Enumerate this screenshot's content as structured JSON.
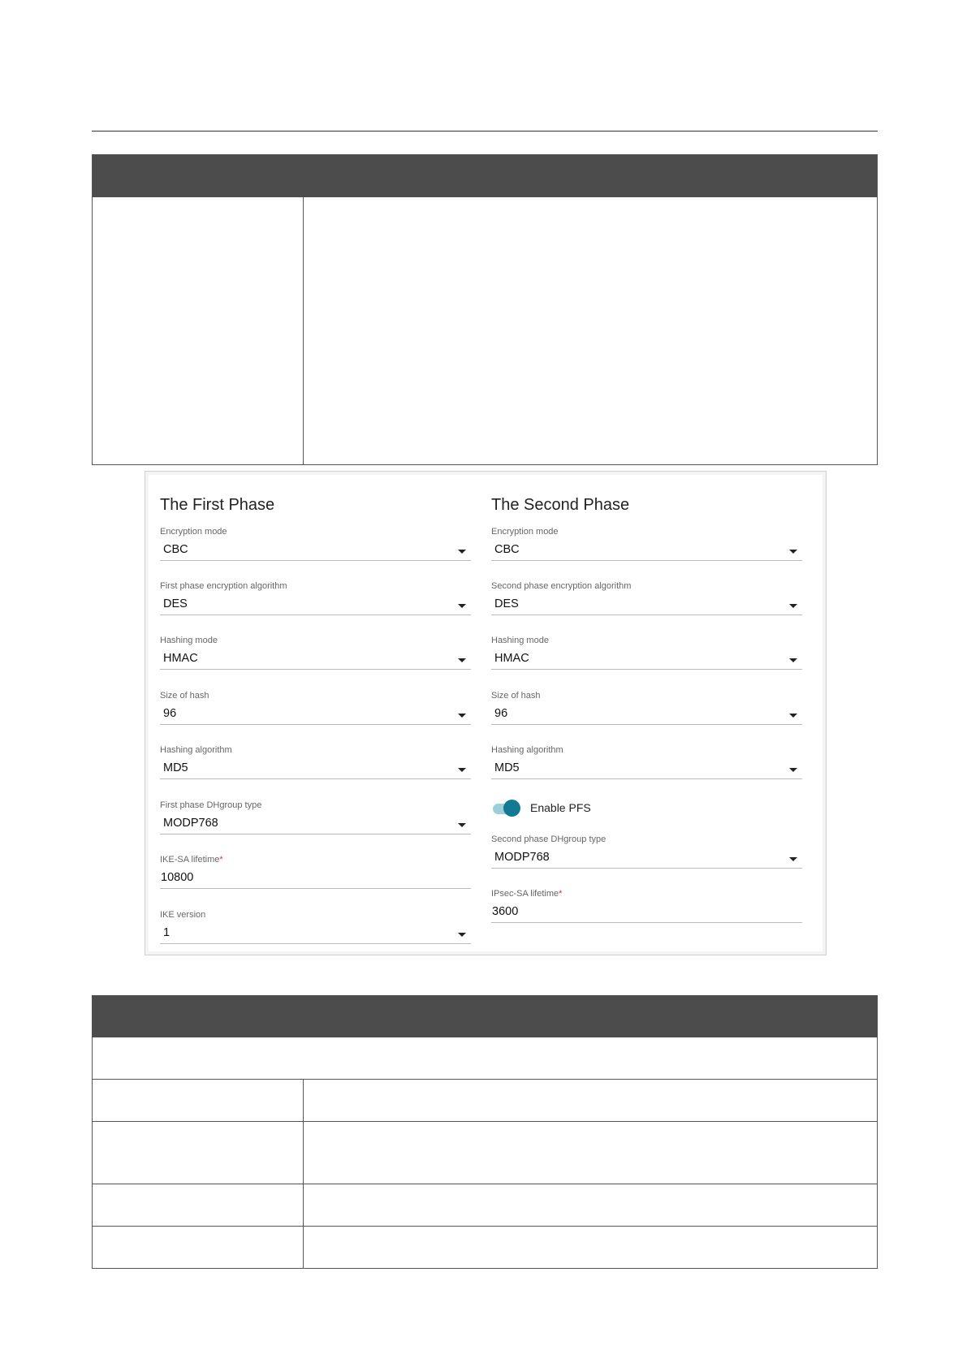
{
  "first_phase": {
    "title": "The First Phase",
    "fields": [
      {
        "label": "Encryption mode",
        "value": "CBC"
      },
      {
        "label": "First phase encryption algorithm",
        "value": "DES"
      },
      {
        "label": "Hashing mode",
        "value": "HMAC"
      },
      {
        "label": "Size of hash",
        "value": "96"
      },
      {
        "label": "Hashing algorithm",
        "value": "MD5"
      },
      {
        "label": "First phase DHgroup type",
        "value": "MODP768"
      },
      {
        "label": "IKE-SA lifetime",
        "required_mark": "*",
        "value": "10800"
      },
      {
        "label": "IKE version",
        "value": "1"
      }
    ]
  },
  "second_phase": {
    "title": "The Second Phase",
    "fields": [
      {
        "label": "Encryption mode",
        "value": "CBC"
      },
      {
        "label": "Second phase encryption algorithm",
        "value": "DES"
      },
      {
        "label": "Hashing mode",
        "value": "HMAC"
      },
      {
        "label": "Size of hash",
        "value": "96"
      },
      {
        "label": "Hashing algorithm",
        "value": "MD5"
      },
      {
        "label": "Second phase DHgroup type",
        "value": "MODP768"
      },
      {
        "label": "IPsec-SA lifetime",
        "required_mark": "*",
        "value": "3600"
      }
    ],
    "pfs": {
      "label": "Enable PFS",
      "enabled": true
    }
  },
  "colors": {
    "table_header": "#4c4c4c",
    "toggle_knob": "#127a93",
    "toggle_track": "#9ccfd9",
    "required_mark": "#dd3333"
  }
}
